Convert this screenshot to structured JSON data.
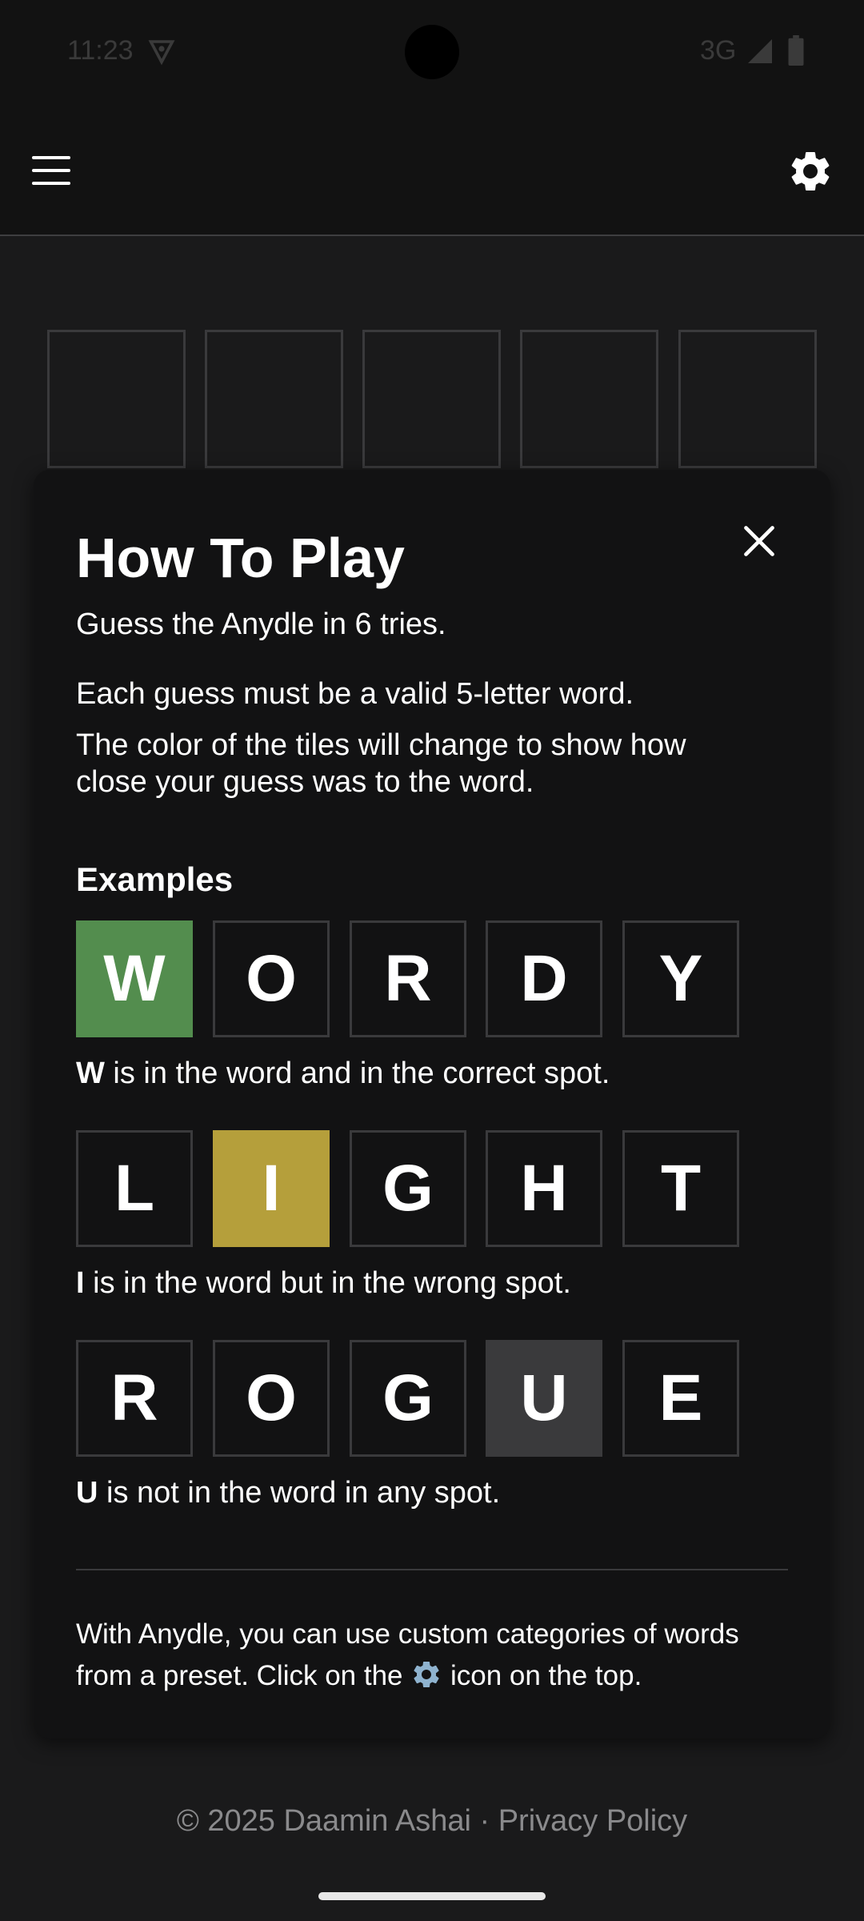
{
  "status_bar": {
    "time": "11:23",
    "network": "3G",
    "vpn_icon": "vpn-key-icon",
    "signal_icon": "signal-icon",
    "battery_icon": "battery-icon"
  },
  "app_bar": {
    "menu_icon": "hamburger-menu-icon",
    "settings_icon": "gear-icon"
  },
  "board": {
    "tiles": [
      "",
      "",
      "",
      "",
      ""
    ]
  },
  "modal": {
    "title": "How To Play",
    "subtitle": "Guess the Anydle in 6 tries.",
    "rule1": "Each guess must be a valid 5-letter word.",
    "rule2_line1": "The color of the tiles will change to show how",
    "rule2_line2": "close your guess was to the word.",
    "examples_title": "Examples",
    "examples": [
      {
        "letters": [
          "W",
          "O",
          "R",
          "D",
          "Y"
        ],
        "highlight_index": 0,
        "state": "correct",
        "bold": "W",
        "text": " is in the word and in the correct spot."
      },
      {
        "letters": [
          "L",
          "I",
          "G",
          "H",
          "T"
        ],
        "highlight_index": 1,
        "state": "present",
        "bold": "I",
        "text": " is in the word but in the wrong spot."
      },
      {
        "letters": [
          "R",
          "O",
          "G",
          "U",
          "E"
        ],
        "highlight_index": 3,
        "state": "absent",
        "bold": "U",
        "text": " is not in the word in any spot."
      }
    ],
    "footer_line1": "With Anydle, you can use custom categories of words",
    "footer_line2_before": "from a preset. Click on the",
    "footer_line2_after": " icon on the top.",
    "close_icon": "close-icon"
  },
  "colors": {
    "correct": "#538d4e",
    "present": "#b59f3b",
    "absent": "#3a3a3c",
    "background": "#121213"
  },
  "copyright": "© 2025 Daamin Ashai · Privacy Policy"
}
